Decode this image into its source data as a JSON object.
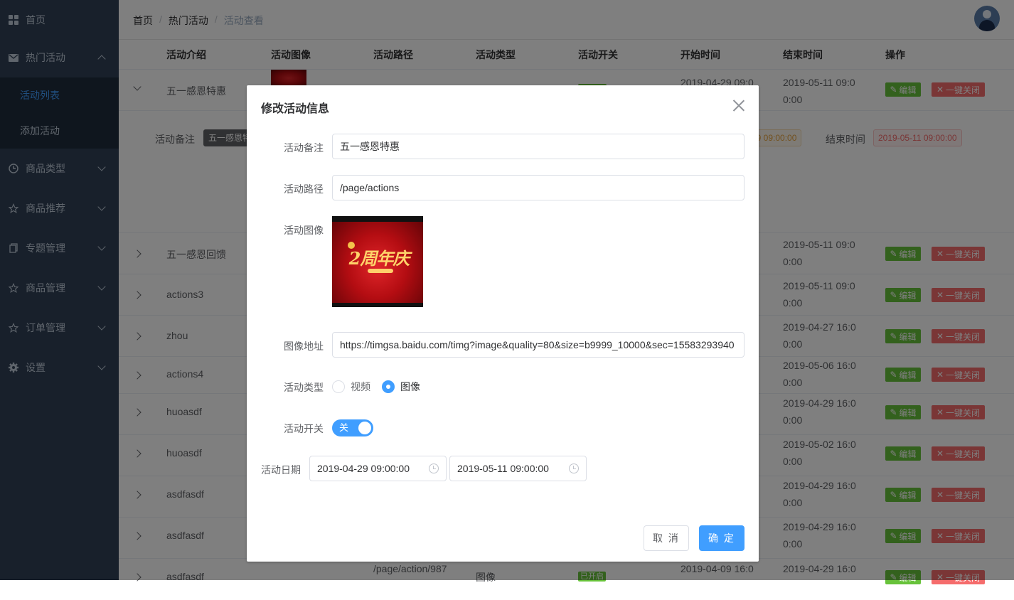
{
  "sidebar": {
    "items": [
      {
        "label": "首页",
        "icon": "dashboard-icon"
      },
      {
        "label": "热门活动",
        "icon": "mail-icon"
      },
      {
        "label": "商品类型",
        "icon": "clock-icon"
      },
      {
        "label": "商品推荐",
        "icon": "star-icon"
      },
      {
        "label": "专题管理",
        "icon": "document-icon"
      },
      {
        "label": "商品管理",
        "icon": "star-icon"
      },
      {
        "label": "订单管理",
        "icon": "star-icon"
      },
      {
        "label": "设置",
        "icon": "gear-icon"
      }
    ],
    "sub_items": [
      {
        "label": "活动列表",
        "active": true
      },
      {
        "label": "添加活动",
        "active": false
      }
    ]
  },
  "breadcrumb": [
    "首页",
    "热门活动",
    "活动查看"
  ],
  "table": {
    "headers": [
      "活动介绍",
      "活动图像",
      "活动路径",
      "活动类型",
      "活动开关",
      "开始时间",
      "结束时间",
      "操作"
    ],
    "edit_label": "编辑",
    "close_label": "一键关闭",
    "rows": [
      {
        "name": "五一感恩特惠",
        "start": "2019-04-29 09:0\n0:00",
        "end": "2019-05-11 09:0\n0:00"
      },
      {
        "name": "五一感恩回馈",
        "end": "2019-05-11 09:0\n0:00"
      },
      {
        "name": "actions3",
        "end": "2019-05-11 09:0\n0:00"
      },
      {
        "name": "zhou",
        "end": "2019-04-27 16:0\n0:00"
      },
      {
        "name": "actions4",
        "end": "2019-05-06 16:0\n0:00"
      },
      {
        "name": "huoasdf",
        "end": "2019-04-29 16:0\n0:00"
      },
      {
        "name": "huoasdf",
        "end": "2019-05-02 16:0\n0:00"
      },
      {
        "name": "asdfasdf",
        "end": "2019-04-29 16:0\n0:00"
      },
      {
        "name": "asdfasdf",
        "end": "2019-04-29 16:0\n0:00"
      },
      {
        "name": "asdfasdf",
        "path": "/page/action/987",
        "type": "图像",
        "switch": "已开启",
        "start": "2019-04-09 16:0",
        "end": "2019-04-29 16:0"
      }
    ],
    "expanded": {
      "remark_label": "活动备注",
      "remark_value": "五一感恩特",
      "start_value": "-29 09:00:00",
      "end_label": "结束时间",
      "end_value": "2019-05-11 09:00:00"
    }
  },
  "dialog": {
    "title": "修改活动信息",
    "remark_label": "活动备注",
    "remark_value": "五一感恩特惠",
    "path_label": "活动路径",
    "path_value": "/page/actions",
    "image_label": "活动图像",
    "image_text": "2周年庆",
    "image_url_label": "图像地址",
    "image_url_value": "https://timgsa.baidu.com/timg?image&quality=80&size=b9999_10000&sec=15583293940",
    "type_label": "活动类型",
    "type_options": [
      "视频",
      "图像"
    ],
    "type_selected": "图像",
    "switch_label": "活动开关",
    "switch_text": "关",
    "date_label": "活动日期",
    "date_start": "2019-04-29 09:00:00",
    "date_end": "2019-05-11 09:00:00",
    "cancel_label": "取 消",
    "confirm_label": "确 定"
  },
  "colors": {
    "sidebar_bg": "#304156",
    "accent": "#409eff",
    "success": "#67c23a",
    "danger": "#f56c6c"
  }
}
